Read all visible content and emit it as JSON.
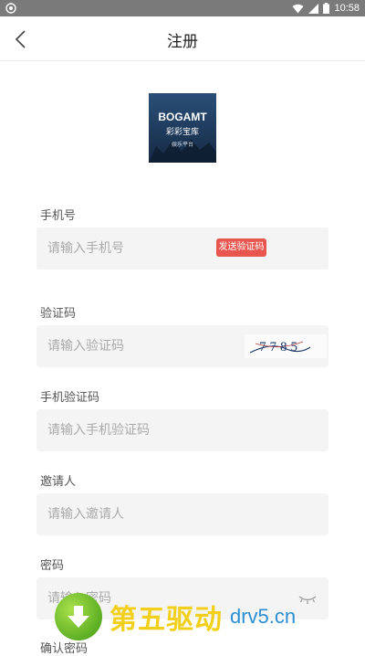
{
  "status_bar": {
    "time": "10:58",
    "icons": [
      "app-icon",
      "wifi-icon",
      "signal-icon",
      "battery-icon"
    ]
  },
  "header": {
    "title": "注册",
    "back_icon": "chevron-left-icon"
  },
  "logo": {
    "text_top": "BOGAMT",
    "text_mid": "彩彩宝库",
    "text_bottom": "娱乐平台"
  },
  "form": {
    "phone": {
      "label": "手机号",
      "placeholder": "请输入手机号",
      "send_code_label": "发送验证码"
    },
    "captcha": {
      "label": "验证码",
      "placeholder": "请输入验证码",
      "image_text": "7785"
    },
    "sms_code": {
      "label": "手机验证码",
      "placeholder": "请输入手机验证码"
    },
    "inviter": {
      "label": "邀请人",
      "placeholder": "请输入邀请人"
    },
    "password": {
      "label": "密码",
      "placeholder": "请输入密码",
      "toggle_icon": "eye-closed-icon"
    },
    "confirm_password": {
      "label": "确认密码"
    }
  },
  "watermark": {
    "brand": "第五驱动",
    "url": "drv5.cn"
  },
  "colors": {
    "accent": "#e9564f",
    "field_bg": "#f4f4f4",
    "status_bar": "#7a7a7a"
  }
}
